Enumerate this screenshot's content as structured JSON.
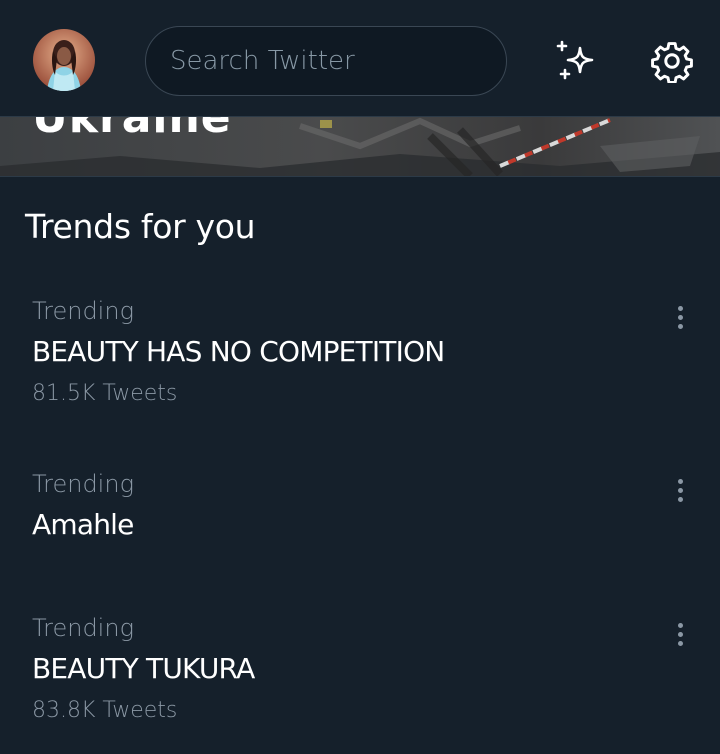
{
  "header": {
    "search_placeholder": "Search Twitter",
    "icons": [
      "avatar",
      "sparkle-icon",
      "gear-icon"
    ]
  },
  "banner": {
    "caption": "Ukraine"
  },
  "trends": {
    "title": "Trends for you",
    "items": [
      {
        "context": "Trending",
        "name": "BEAUTY HAS NO COMPETITION",
        "count": "81.5K Tweets"
      },
      {
        "context": "Trending",
        "name": "Amahle",
        "count": ""
      },
      {
        "context": "Trending",
        "name": "BEAUTY TUKURA",
        "count": "83.8K Tweets"
      }
    ]
  },
  "colors": {
    "background": "#15202b",
    "secondary_text": "#8b98a5",
    "border": "#2c3a47"
  }
}
